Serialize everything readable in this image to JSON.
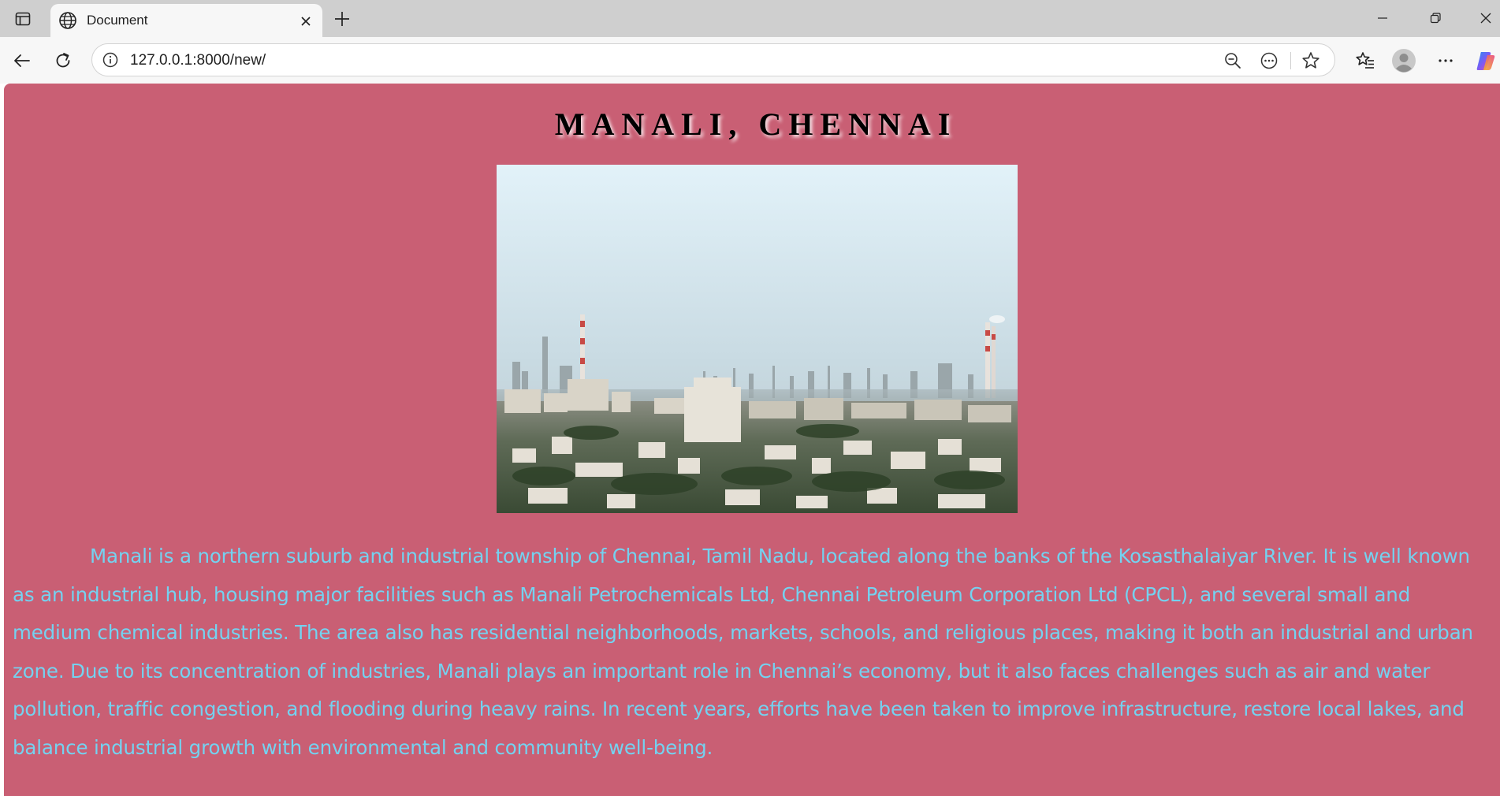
{
  "browser": {
    "tab": {
      "title": "Document",
      "favicon_icon": "globe-icon"
    },
    "toolbar": {
      "url": "127.0.0.1:8000/new/"
    }
  },
  "page": {
    "heading": "MANALI, CHENNAI",
    "image": {
      "subject": "Aerial view of an urban skyline with industrial chimneys"
    },
    "paragraph": "Manali is a northern suburb and industrial township of Chennai, Tamil Nadu, located along the banks of the Kosasthalaiyar River. It is well known as an industrial hub, housing major facilities such as Manali Petrochemicals Ltd, Chennai Petroleum Corporation Ltd (CPCL), and several small and medium chemical industries. The area also has residential neighborhoods, markets, schools, and religious places, making it both an industrial and urban zone. Due to its concentration of industries, Manali plays an important role in Chennai’s economy, but it also faces challenges such as air and water pollution, traffic congestion, and flooding during heavy rains. In recent years, efforts have been taken to improve infrastructure, restore local lakes, and balance industrial growth with environmental and community well-being."
  },
  "colors": {
    "page_background": "#c95f74",
    "paragraph_text": "#74d2f0",
    "heading_text": "#000000"
  }
}
